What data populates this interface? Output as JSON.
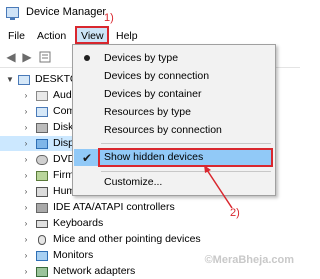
{
  "window": {
    "title": "Device Manager"
  },
  "annotations": {
    "step1": "1)",
    "step2": "2)"
  },
  "menubar": {
    "items": [
      "File",
      "Action",
      "View",
      "Help"
    ]
  },
  "tree": {
    "root": "DESKTO",
    "items": [
      "Aud",
      "Com",
      "Disk",
      "Disp",
      "DVD",
      "Firm",
      "Hum",
      "IDE ATA/ATAPI controllers",
      "Keyboards",
      "Mice and other pointing devices",
      "Monitors",
      "Network adapters"
    ]
  },
  "view_menu": {
    "items": [
      "Devices by type",
      "Devices by connection",
      "Devices by container",
      "Resources by type",
      "Resources by connection",
      "Show hidden devices",
      "Customize..."
    ]
  },
  "watermark": "©MeraBheja.com",
  "colors": {
    "annotation": "#d9272e",
    "highlight": "#91c9f7",
    "selection": "#cce8ff"
  }
}
